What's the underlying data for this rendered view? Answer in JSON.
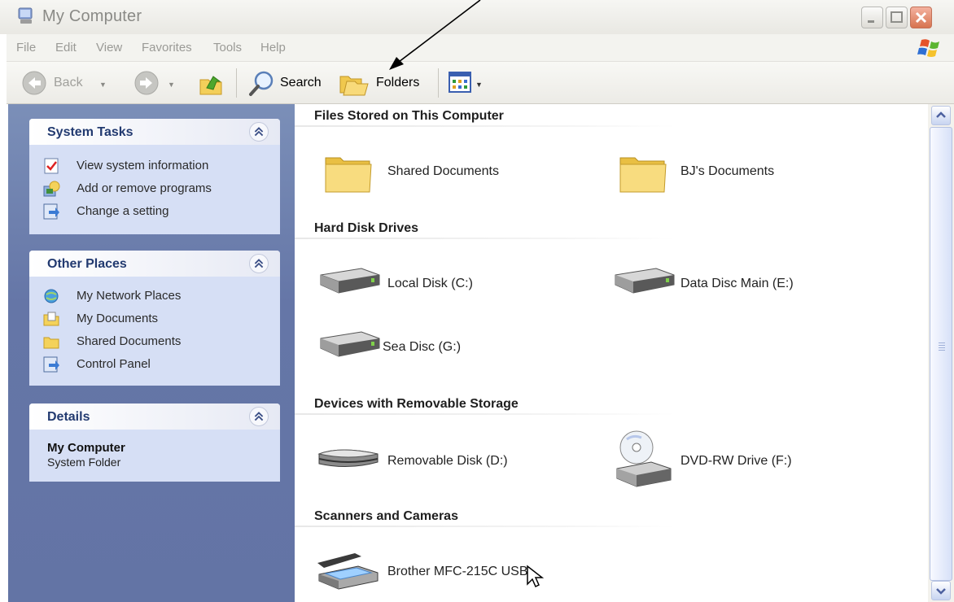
{
  "window": {
    "title": "My Computer",
    "icon": "my-computer-icon"
  },
  "menu": [
    "File",
    "Edit",
    "View",
    "Favorites",
    "Tools",
    "Help"
  ],
  "toolbar": {
    "back_label": "Back",
    "search_label": "Search",
    "folders_label": "Folders",
    "icons": [
      "back-arrow-icon",
      "forward-arrow-icon",
      "up-folder-icon",
      "search-magnifier-icon",
      "folders-icon",
      "views-grid-icon"
    ]
  },
  "sidebar": {
    "system_tasks": {
      "title": "System Tasks",
      "items": [
        {
          "label": "View system information",
          "icon": "system-info-icon"
        },
        {
          "label": "Add or remove programs",
          "icon": "add-remove-programs-icon"
        },
        {
          "label": "Change a setting",
          "icon": "control-setting-icon"
        }
      ]
    },
    "other_places": {
      "title": "Other Places",
      "items": [
        {
          "label": "My Network Places",
          "icon": "network-places-icon"
        },
        {
          "label": "My Documents",
          "icon": "my-documents-icon"
        },
        {
          "label": "Shared Documents",
          "icon": "shared-folder-icon"
        },
        {
          "label": "Control Panel",
          "icon": "control-panel-icon"
        }
      ]
    },
    "details": {
      "title": "Details",
      "name": "My Computer",
      "type": "System Folder"
    }
  },
  "content": {
    "groups": [
      {
        "title": "Files Stored on This Computer",
        "items": [
          {
            "label": "Shared Documents",
            "icon": "folder-icon"
          },
          {
            "label": "BJ's Documents",
            "icon": "folder-icon"
          }
        ]
      },
      {
        "title": "Hard Disk Drives",
        "items": [
          {
            "label": "Local Disk (C:)",
            "icon": "hard-disk-icon"
          },
          {
            "label": "Data Disc Main (E:)",
            "icon": "hard-disk-icon"
          },
          {
            "label": "Sea Disc (G:)",
            "icon": "hard-disk-icon"
          }
        ]
      },
      {
        "title": "Devices with Removable Storage",
        "items": [
          {
            "label": "Removable Disk (D:)",
            "icon": "removable-disk-icon"
          },
          {
            "label": "DVD-RW Drive (F:)",
            "icon": "dvd-drive-icon"
          }
        ]
      },
      {
        "title": "Scanners and Cameras",
        "items": [
          {
            "label": "Brother MFC-215C USB",
            "icon": "scanner-icon"
          }
        ]
      }
    ]
  },
  "colors": {
    "task_pane_blue": "#6d80ae",
    "panel_body": "#d6dff5",
    "panel_title": "#223a70",
    "folder_yellow": "#f6d56a",
    "annotation_arrow": "#000000"
  }
}
